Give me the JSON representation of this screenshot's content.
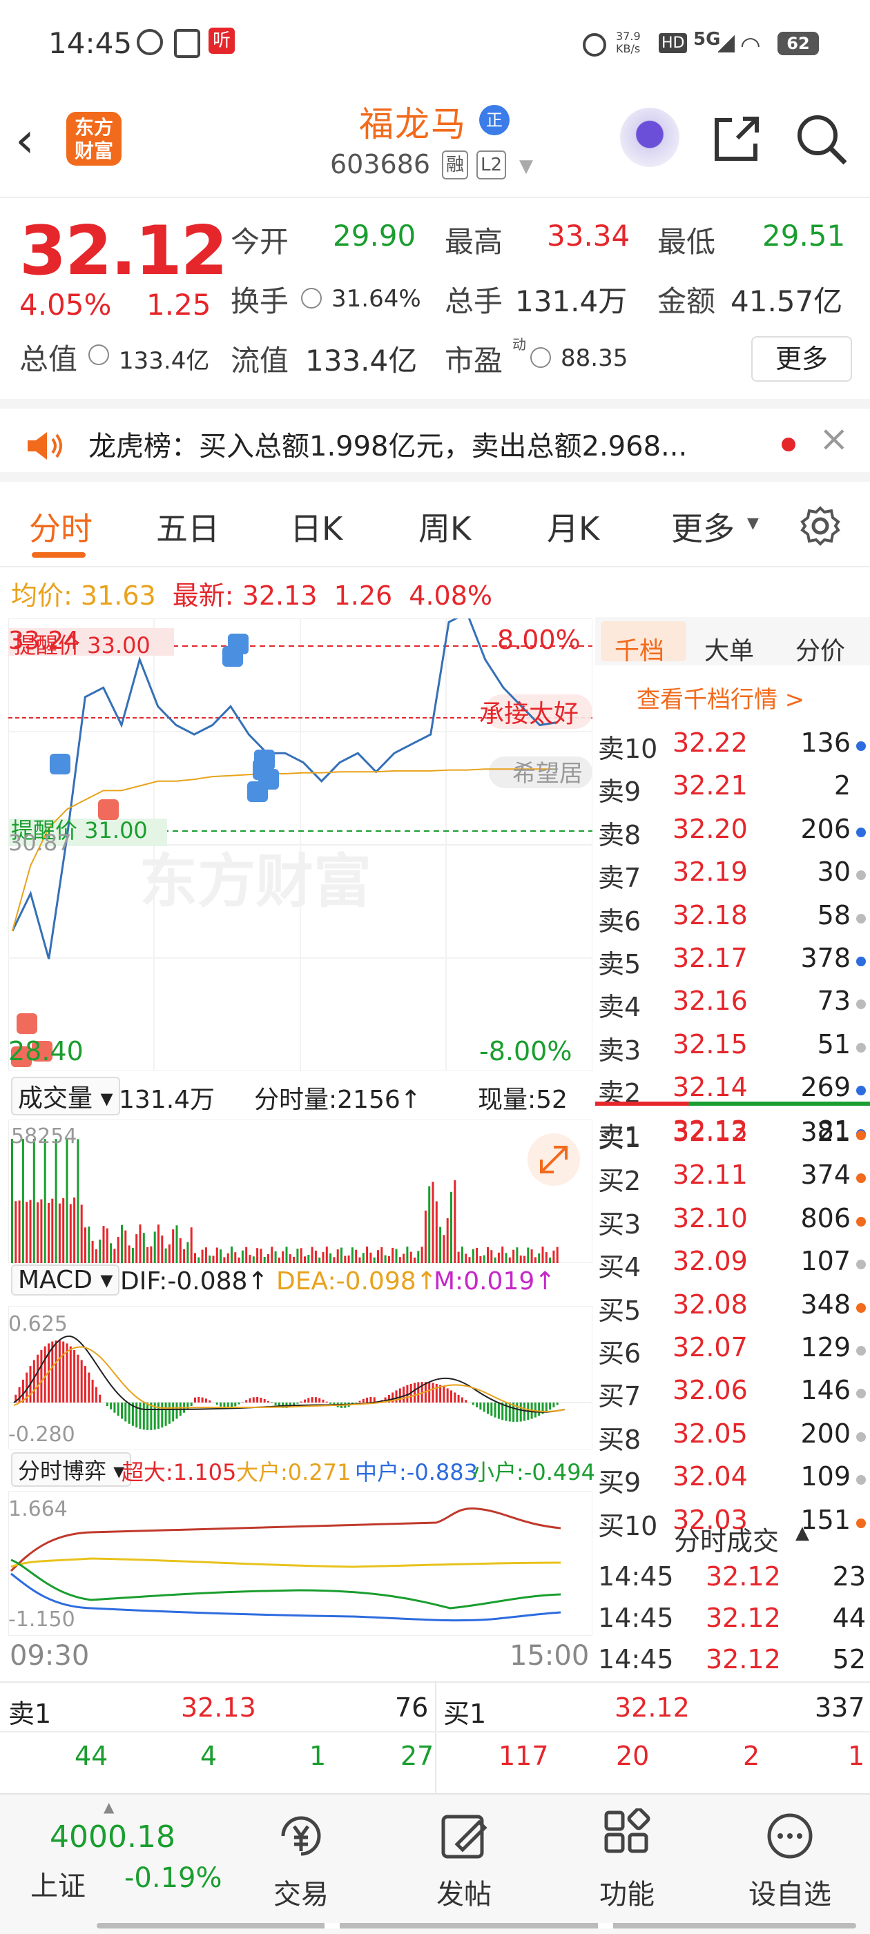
{
  "status_bar": {
    "time": "14:45",
    "net_speed": "37.9\nKB/s",
    "hd": "HD",
    "network": "5G",
    "battery": "62",
    "app_badge": "听"
  },
  "header": {
    "back_icon": "chevron-left-icon",
    "logo": "东方\n财富",
    "name": "福龙马",
    "name_badge": "正",
    "code": "603686",
    "badge_margin": "融",
    "badge_level": "L2",
    "icons": [
      "robot-assistant-icon",
      "share-icon",
      "search-icon"
    ]
  },
  "quote": {
    "price": "32.12",
    "change_pct": "4.05%",
    "change": "1.25",
    "open_label": "今开",
    "open": "29.90",
    "high_label": "最高",
    "high": "33.34",
    "low_label": "最低",
    "low": "29.51",
    "turnover_label": "换手",
    "turnover": "31.64%",
    "volume_label": "总手",
    "volume": "131.4万",
    "amount_label": "金额",
    "amount": "41.57亿",
    "mktcap_label": "总值",
    "mktcap": "133.4亿",
    "float_label": "流值",
    "float_cap": "133.4亿",
    "pe_label": "市盈",
    "pe_sup": "动",
    "pe": "88.35",
    "more": "更多"
  },
  "news": {
    "text": "龙虎榜：买入总额1.998亿元，卖出总额2.968...",
    "icons": [
      "speaker-icon",
      "close-icon"
    ]
  },
  "tabs": [
    "分时",
    "五日",
    "日K",
    "周K",
    "月K",
    "更多"
  ],
  "avg_line": {
    "avg_label": "均价:",
    "avg": "31.63",
    "latest_label": "最新:",
    "latest": "32.13",
    "chg": "1.26",
    "pct": "4.08%"
  },
  "chart": {
    "top_price": "33.24",
    "top_pct": "8.00%",
    "mid_price": "30.87",
    "bottom_price": "28.40",
    "bottom_pct": "-8.00%",
    "alert_high": "提醒价 33.00",
    "alert_low": "提醒价 31.00",
    "tip1": "承接太好",
    "tip2": "希望居",
    "watermark": "东方财富",
    "time_start": "09:30",
    "time_end": "15:00"
  },
  "chart_data": [
    {
      "type": "line",
      "title": "",
      "ylim": [
        28.4,
        33.24
      ],
      "x_range": [
        "09:30",
        "15:00"
      ],
      "series": [
        {
          "values": [
            29.9,
            30.3,
            29.6,
            30.9,
            32.4,
            32.5,
            32.1,
            32.8,
            32.3,
            32.1,
            32.0,
            32.1,
            32.3,
            32.0,
            31.8,
            31.8,
            31.7,
            31.5,
            31.7,
            31.8,
            31.6,
            31.8,
            31.9,
            32.0,
            33.2,
            33.3,
            32.8,
            32.5,
            32.3,
            32.1,
            32.13
          ]
        },
        {
          "values": [
            29.9,
            30.6,
            31.0,
            31.2,
            31.3,
            31.4,
            31.4,
            31.45,
            31.5,
            31.5,
            31.52,
            31.55,
            31.56,
            31.57,
            31.58,
            31.58,
            31.59,
            31.59,
            31.6,
            31.6,
            31.6,
            31.61,
            31.61,
            31.61,
            31.62,
            31.62,
            31.63,
            31.63,
            31.63,
            31.63,
            31.63
          ]
        }
      ]
    },
    {
      "type": "bar",
      "title": "",
      "ylim": [
        0,
        58254
      ]
    }
  ],
  "volume_panel": {
    "label": "成交量",
    "total": "131.4万",
    "fenshi": "分时量:2156↑",
    "current": "现量:52",
    "max": "58254"
  },
  "macd_panel": {
    "label": "MACD",
    "dif": "DIF:-0.088↑",
    "dea": "DEA:-0.098↑",
    "m": "M:0.019↑",
    "max": "0.625",
    "min": "-0.280"
  },
  "flow_panel": {
    "label": "分时博弈",
    "super": "超大:1.105",
    "large": "大户:0.271",
    "mid": "中户:-0.883",
    "small": "小户:-0.494",
    "max": "1.664",
    "min": "-1.150"
  },
  "book": {
    "tabs": [
      "千档",
      "大单",
      "分价"
    ],
    "link": "查看千档行情 >",
    "asks": [
      {
        "n": "卖10",
        "p": "32.22",
        "q": "136",
        "dot": "#2d6cdf"
      },
      {
        "n": "卖9",
        "p": "32.21",
        "q": "2",
        "dot": ""
      },
      {
        "n": "卖8",
        "p": "32.20",
        "q": "206",
        "dot": "#2d6cdf"
      },
      {
        "n": "卖7",
        "p": "32.19",
        "q": "30",
        "dot": "#bbbbbb"
      },
      {
        "n": "卖6",
        "p": "32.18",
        "q": "58",
        "dot": "#bbbbbb"
      },
      {
        "n": "卖5",
        "p": "32.17",
        "q": "378",
        "dot": "#2d6cdf"
      },
      {
        "n": "卖4",
        "p": "32.16",
        "q": "73",
        "dot": "#bbbbbb"
      },
      {
        "n": "卖3",
        "p": "32.15",
        "q": "51",
        "dot": "#bbbbbb"
      },
      {
        "n": "卖2",
        "p": "32.14",
        "q": "269",
        "dot": "#2d6cdf"
      },
      {
        "n": "卖1",
        "p": "32.13",
        "q": "81",
        "dot": "#2d6cdf"
      }
    ],
    "bids": [
      {
        "n": "买1",
        "p": "32.12",
        "q": "321",
        "dot": "#f26a1b"
      },
      {
        "n": "买2",
        "p": "32.11",
        "q": "374",
        "dot": "#f26a1b"
      },
      {
        "n": "买3",
        "p": "32.10",
        "q": "806",
        "dot": "#f26a1b"
      },
      {
        "n": "买4",
        "p": "32.09",
        "q": "107",
        "dot": "#bbbbbb"
      },
      {
        "n": "买5",
        "p": "32.08",
        "q": "348",
        "dot": "#f26a1b"
      },
      {
        "n": "买6",
        "p": "32.07",
        "q": "129",
        "dot": "#bbbbbb"
      },
      {
        "n": "买7",
        "p": "32.06",
        "q": "146",
        "dot": "#bbbbbb"
      },
      {
        "n": "买8",
        "p": "32.05",
        "q": "200",
        "dot": "#bbbbbb"
      },
      {
        "n": "买9",
        "p": "32.04",
        "q": "109",
        "dot": "#bbbbbb"
      },
      {
        "n": "买10",
        "p": "32.03",
        "q": "151",
        "dot": "#f26a1b"
      }
    ],
    "trades_title": "分时成交",
    "trades": [
      {
        "t": "14:45",
        "p": "32.12",
        "q": "23"
      },
      {
        "t": "14:45",
        "p": "32.12",
        "q": "44"
      },
      {
        "t": "14:45",
        "p": "32.12",
        "q": "52"
      }
    ]
  },
  "bottom_quote": {
    "ask_label": "卖1",
    "ask_price": "32.13",
    "ask_qty": "76",
    "bid_label": "买1",
    "bid_price": "32.12",
    "bid_qty": "337",
    "ask_nums": [
      "44",
      "4",
      "1",
      "27"
    ],
    "bid_nums": [
      "117",
      "20",
      "2",
      "1"
    ]
  },
  "bottom_bar": {
    "index_value": "4000.18",
    "index_name": "上证",
    "index_pct": "-0.19%",
    "items": [
      {
        "label": "交易",
        "icon": "trade-yen-icon"
      },
      {
        "label": "发帖",
        "icon": "post-edit-icon"
      },
      {
        "label": "功能",
        "icon": "grid-apps-icon"
      },
      {
        "label": "设自选",
        "icon": "more-dots-icon"
      }
    ]
  },
  "colors": {
    "up": "#e5262b",
    "down": "#1a9e2f",
    "accent": "#f26a1b",
    "price_line": "#3570b8",
    "avg_line": "#e8a21c"
  }
}
